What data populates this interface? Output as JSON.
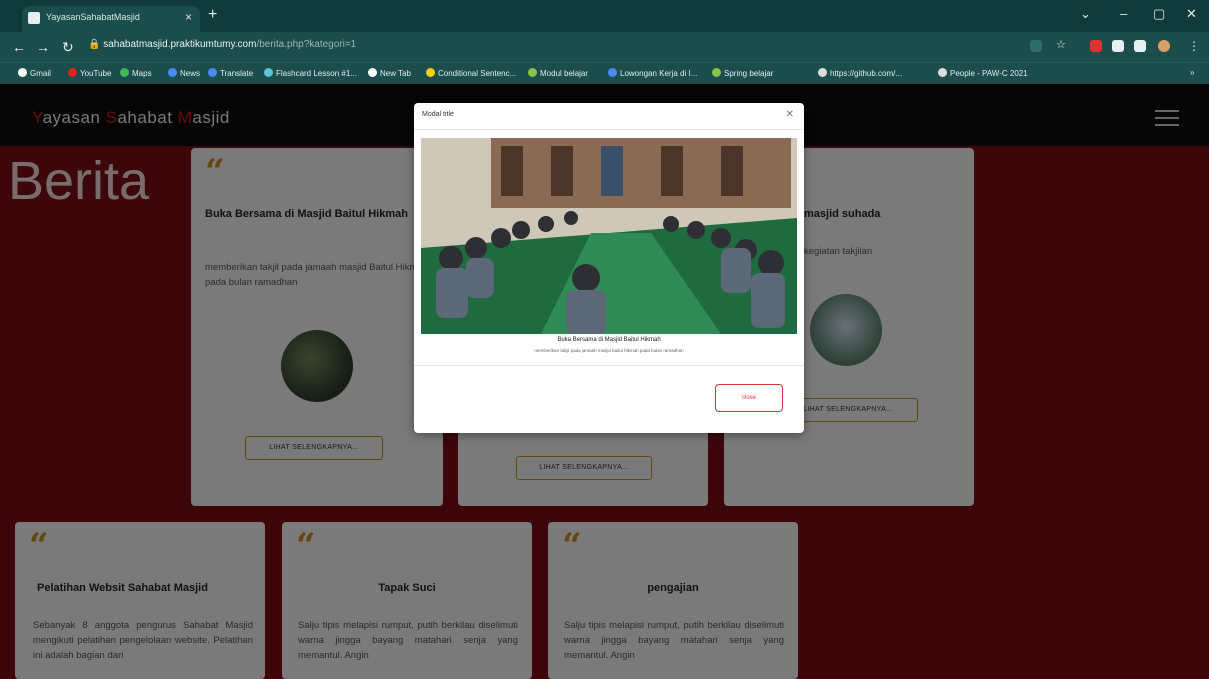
{
  "browser": {
    "tab_title": "YayasanSahabatMasjid",
    "url_domain": "sahabatmasjid.praktikumtumy.com",
    "url_path": "/berita.php?kategori=1",
    "bookmarks": [
      "Gmail",
      "YouTube",
      "Maps",
      "News",
      "Translate",
      "Flashcard Lesson #1...",
      "New Tab",
      "Conditional Sentenc...",
      "Modul belajar",
      "Lowongan Kerja di I...",
      "Spring belajar",
      "https://github.com/...",
      "People - PAW-C 2021"
    ]
  },
  "site": {
    "logo_parts": [
      {
        "cap": "Y",
        "rest": "ayasan "
      },
      {
        "cap": "S",
        "rest": "ahabat "
      },
      {
        "cap": "M",
        "rest": "asjid"
      }
    ],
    "heading": "Berita"
  },
  "cards": [
    {
      "title": "Buka Bersama di Masjid Baitul Hikmah",
      "desc": "memberikan takjil pada jamaah masjid Baitul Hikmah pada bulan ramadhan",
      "more": "LIHAT SELENGKAPNYA..."
    },
    {
      "title": "",
      "desc": "",
      "more": "LIHAT SELENGKAPNYA..."
    },
    {
      "title": "masjid suhada",
      "desc": "kegiatan takjilan",
      "more": "LIHAT SELENGKAPNYA..."
    },
    {
      "title": "Pelatihan Websit Sahabat Masjid",
      "desc": "Sebanyak 8 anggota pengurus Sahabat Masjid mengikuti pelatihan pengelolaan website. Pelatihan ini adalah bagian dari"
    },
    {
      "title": "Tapak Suci",
      "desc": "Salju tipis melapisi rumput, putih berkilau diselimuti warna jingga bayang matahari senja yang memantul. Angin"
    },
    {
      "title": "pengajian",
      "desc": "Salju tipis melapisi rumput, putih berkilau diselimuti warna jingga bayang matahari senja yang memantul. Angin"
    }
  ],
  "modal": {
    "title": "Modal title",
    "caption_title": "Buka Bersama di Masjid Baitul Hikmah",
    "caption_desc": "memberikan takjil pada jamaah masjid baitul hikmah pada bulan ramadhan",
    "close_label": "close"
  },
  "colors": {
    "accent": "#c98a1a",
    "brand_red": "#d31b2b",
    "bg": "#7a0d16"
  }
}
